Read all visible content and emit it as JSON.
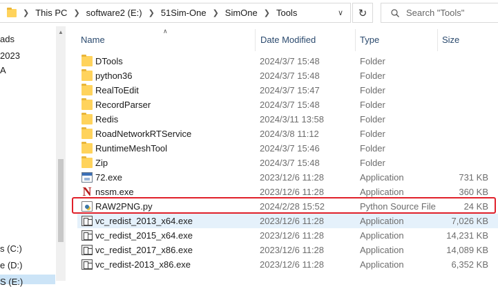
{
  "address": {
    "crumbs": [
      "This PC",
      "software2 (E:)",
      "51Sim-One",
      "SimOne",
      "Tools"
    ]
  },
  "search": {
    "placeholder": "Search \"Tools\""
  },
  "nav": {
    "items": [
      "ads",
      "2023",
      "A",
      "s (C:)",
      "e (D:)",
      "S (E:)"
    ]
  },
  "columns": {
    "name": "Name",
    "date": "Date Modified",
    "type": "Type",
    "size": "Size"
  },
  "files": [
    {
      "name": "DTools",
      "date": "2024/3/7 15:48",
      "type": "Folder",
      "size": "",
      "icon": "folder-icon"
    },
    {
      "name": "python36",
      "date": "2024/3/7 15:48",
      "type": "Folder",
      "size": "",
      "icon": "folder-icon"
    },
    {
      "name": "RealToEdit",
      "date": "2024/3/7 15:47",
      "type": "Folder",
      "size": "",
      "icon": "folder-icon"
    },
    {
      "name": "RecordParser",
      "date": "2024/3/7 15:48",
      "type": "Folder",
      "size": "",
      "icon": "folder-icon"
    },
    {
      "name": "Redis",
      "date": "2024/3/11 13:58",
      "type": "Folder",
      "size": "",
      "icon": "folder-icon"
    },
    {
      "name": "RoadNetworkRTService",
      "date": "2024/3/8 11:12",
      "type": "Folder",
      "size": "",
      "icon": "folder-icon"
    },
    {
      "name": "RuntimeMeshTool",
      "date": "2024/3/7 15:46",
      "type": "Folder",
      "size": "",
      "icon": "folder-icon"
    },
    {
      "name": "Zip",
      "date": "2024/3/7 15:48",
      "type": "Folder",
      "size": "",
      "icon": "folder-icon"
    },
    {
      "name": "72.exe",
      "date": "2023/12/6 11:28",
      "type": "Application",
      "size": "731 KB",
      "icon": "exe-icon"
    },
    {
      "name": "nssm.exe",
      "date": "2023/12/6 11:28",
      "type": "Application",
      "size": "360 KB",
      "icon": "nssm-icon"
    },
    {
      "name": "RAW2PNG.py",
      "date": "2024/2/28 15:52",
      "type": "Python Source File",
      "size": "24 KB",
      "icon": "python-file-icon"
    },
    {
      "name": "vc_redist_2013_x64.exe",
      "date": "2023/12/6 11:28",
      "type": "Application",
      "size": "7,026 KB",
      "icon": "installer-icon"
    },
    {
      "name": "vc_redist_2015_x64.exe",
      "date": "2023/12/6 11:28",
      "type": "Application",
      "size": "14,231 KB",
      "icon": "installer-icon"
    },
    {
      "name": "vc_redist_2017_x86.exe",
      "date": "2023/12/6 11:28",
      "type": "Application",
      "size": "14,089 KB",
      "icon": "installer-icon"
    },
    {
      "name": "vc_redist-2013_x86.exe",
      "date": "2023/12/6 11:28",
      "type": "Application",
      "size": "6,352 KB",
      "icon": "installer-icon"
    }
  ],
  "highlight_color": "#e0202a"
}
